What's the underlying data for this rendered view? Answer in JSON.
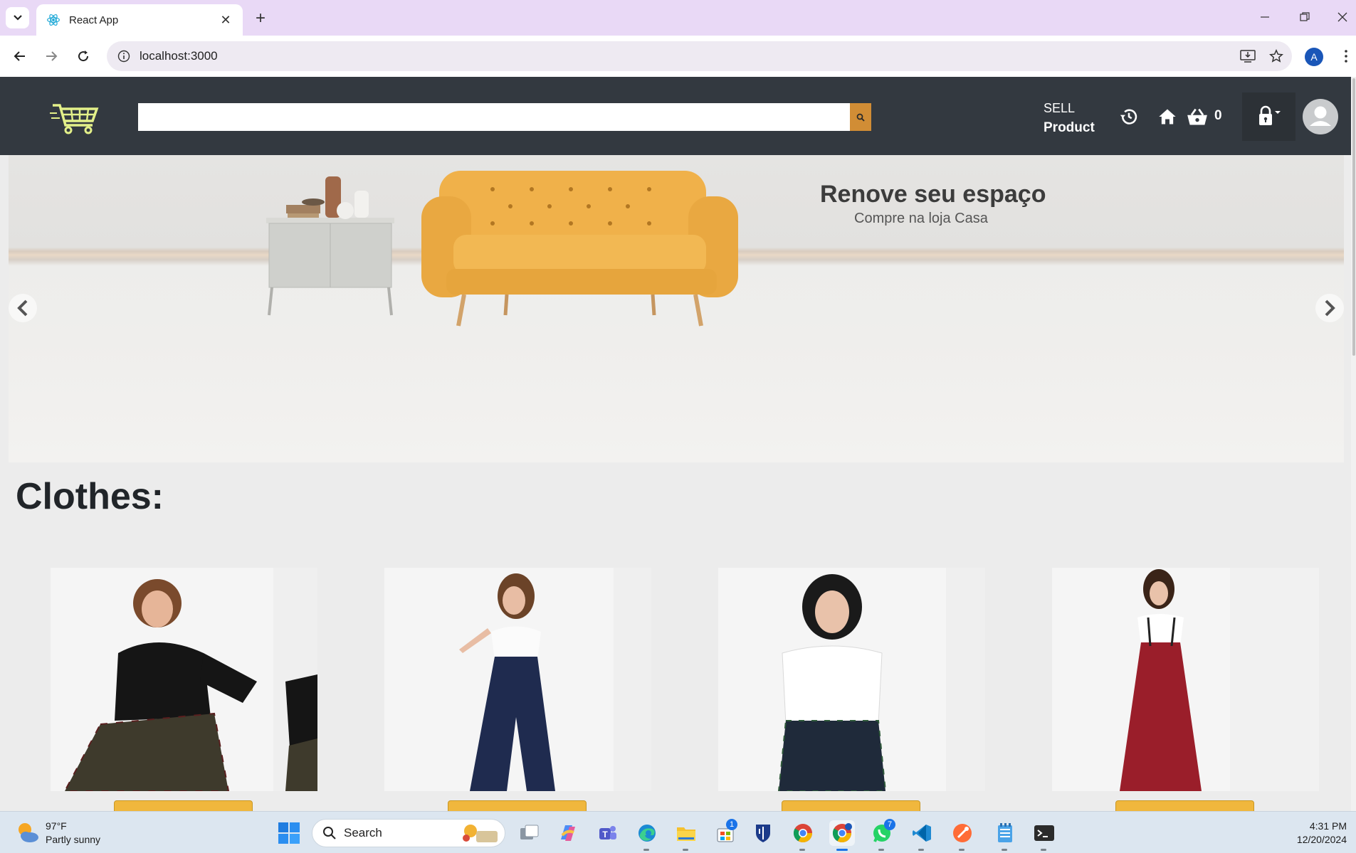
{
  "browser": {
    "tab_title": "React App",
    "url": "localhost:3000",
    "profile_initial": "A"
  },
  "header": {
    "search_placeholder": "",
    "sell_label": "SELL",
    "product_label": "Product",
    "cart_count": "0",
    "accent_color": "#d18d35",
    "logo_color": "#e3f089"
  },
  "banner": {
    "title": "Renove seu espaço",
    "subtitle": "Compre na loja Casa"
  },
  "section": {
    "title": "Clothes:"
  },
  "products": [
    {
      "image": "woman-black-top-plaid-overalls",
      "button_color": "#f0b73d"
    },
    {
      "image": "woman-white-blouse-navy-pinstripe-pants",
      "button_color": "#f0b73d"
    },
    {
      "image": "woman-white-shirt-plaid-skirt",
      "button_color": "#f0b73d"
    },
    {
      "image": "woman-white-blouse-red-wide-pants",
      "button_color": "#f0b73d"
    }
  ],
  "taskbar": {
    "weather_temp": "97°F",
    "weather_desc": "Partly sunny",
    "search_label": "Search",
    "time": "4:31 PM",
    "date": "12/20/2024",
    "store_badge": "1",
    "whatsapp_badge": "7"
  }
}
